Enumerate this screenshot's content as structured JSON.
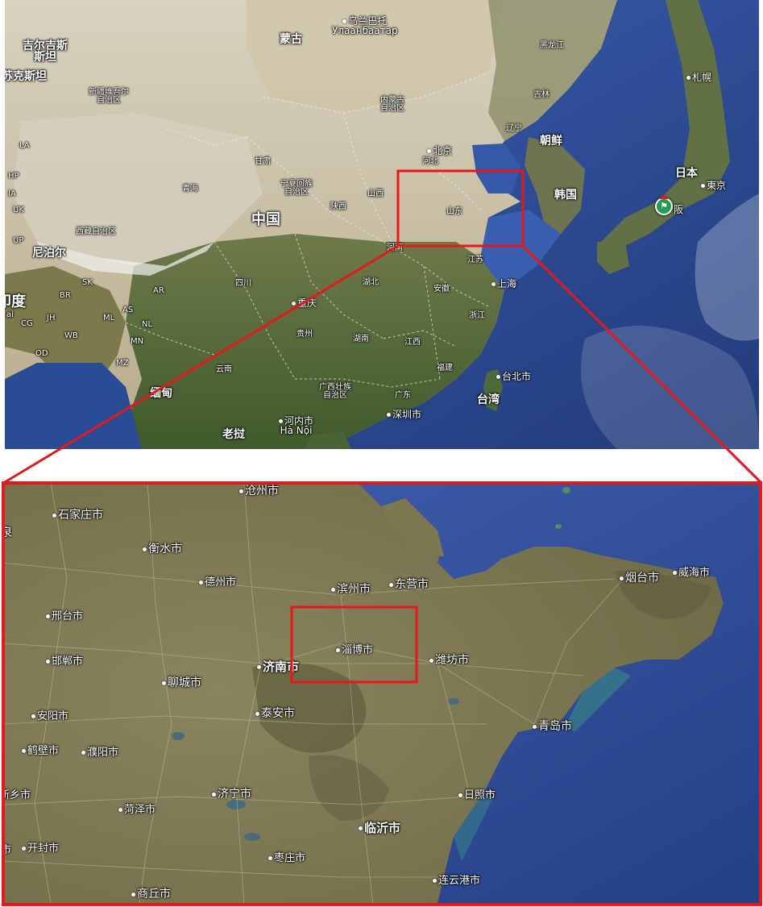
{
  "top_map": {
    "labels": {
      "kyrgyzstan": "吉尔吉斯\n斯坦",
      "kazakhstan_part": "苏克斯坦",
      "xinjiang": "新疆维吾尔\n自治区",
      "mongolia": "蒙古",
      "ulaanbaatar": "乌兰巴托\nУлаанбаатар",
      "inner_mongolia": "内蒙古\n自治区",
      "heilongjiang": "黑龙江",
      "jilin": "吉林",
      "liaoning": "辽宁",
      "sapporo": "札幌",
      "north_korea": "朝鲜",
      "japan": "日本",
      "tokyo": "東京",
      "south_korea": "韩国",
      "osaka": "阪",
      "gansu": "甘肃",
      "qinghai": "青海",
      "ningxia": "宁夏回族\n自治区",
      "shanxi": "山西",
      "shaanxi": "陕西",
      "beijing": "北京",
      "hebei": "河北",
      "shandong": "山东",
      "henan": "河南",
      "china": "中国",
      "tibet": "西藏自治区",
      "nepal": "尼泊尔",
      "india": "印度",
      "sichuan": "四川",
      "chongqing": "重庆",
      "hubei": "湖北",
      "anhui": "安徽",
      "jiangsu": "江苏",
      "shanghai": "上海",
      "zhejiang": "浙江",
      "guizhou": "贵州",
      "hunan": "湖南",
      "jiangxi": "江西",
      "fujian": "福建",
      "taipei": "台北市",
      "taiwan": "台湾",
      "yunnan": "云南",
      "guangxi": "广西壮族\n自治区",
      "guangdong": "广东",
      "shenzhen": "深圳市",
      "hanoi": "河内市\nHà Nội",
      "myanmar": "缅甸",
      "laos": "老挝",
      "ar": "AR",
      "as": "AS",
      "nl": "NL",
      "mn": "MN",
      "mz": "MZ",
      "ml": "ML",
      "wb": "WB",
      "sk": "SK",
      "br": "BR",
      "jh": "JH",
      "cg": "CG",
      "od": "OD",
      "up": "UP",
      "uk": "UK",
      "hp": "HP",
      "ia": "IA",
      "ai": "ai",
      "la": "LA"
    }
  },
  "bottom_map": {
    "cities": {
      "cangzhou": "沧州市",
      "shijiazhuang": "石家庄市",
      "hengshui": "衡水市",
      "dezhou": "德州市",
      "binzhou": "滨州市",
      "dongying": "东营市",
      "yantai": "烟台市",
      "weihai": "威海市",
      "xingtai": "邢台市",
      "zibo": "淄博市",
      "handan": "邯郸市",
      "jinan": "济南市",
      "weifang": "潍坊市",
      "liaocheng": "聊城市",
      "taian": "泰安市",
      "anyang": "安阳市",
      "qingdao": "青岛市",
      "hebi": "鹤壁市",
      "puyang": "濮阳市",
      "xinxiang": "新乡市",
      "jining": "济宁市",
      "rizhao": "日照市",
      "heze": "菏泽市",
      "linyi": "临沂市",
      "kaifeng": "开封市",
      "zaozhuang": "枣庄市",
      "lianyungang": "连云港市",
      "shangqiu": "商丘市",
      "edge_left": "泉",
      "edge_left2": "市"
    }
  },
  "colors": {
    "highlight": "#e3191c",
    "sea": "#2f4f9a",
    "land_top": "#b9b39a",
    "land_bottom": "#7d7754"
  },
  "icons": {
    "place_marker": "flag-marker-icon"
  }
}
